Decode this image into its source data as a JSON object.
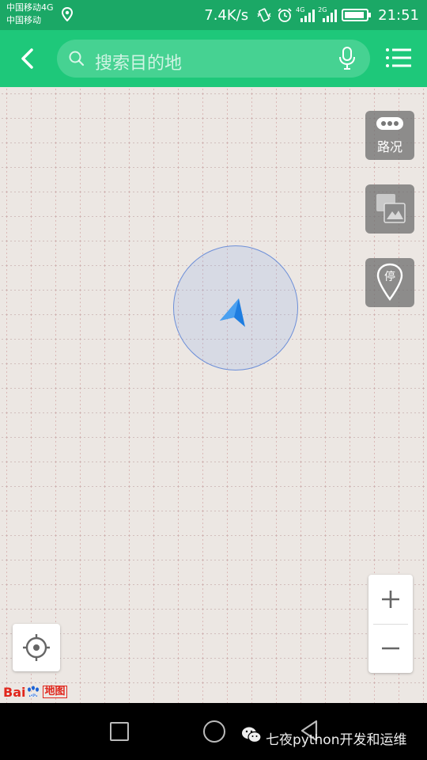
{
  "status_bar": {
    "carrier_1": "中国移动4G",
    "carrier_2": "中国移动",
    "net_speed": "7.4K/s",
    "sim1_tag": "4G",
    "sim2_tag": "2G",
    "time": "21:51"
  },
  "header": {
    "search_placeholder": "搜索目的地"
  },
  "map_controls": {
    "traffic_label": "路况",
    "parking_label": "停",
    "zoom_in": "+",
    "zoom_out": "−"
  },
  "logo": {
    "bai": "Bai",
    "du": "du",
    "map": "地图"
  },
  "watermark": "七夜python开发和运维",
  "colors": {
    "status_bar": "#1ba866",
    "app_bar": "#1ec87a",
    "map_bg": "#ece7e3",
    "nav_arrow": "#1e7de0",
    "logo_red": "#e1261c"
  },
  "icons": [
    "chevron-left-icon",
    "search-icon",
    "mic-icon",
    "menu-icon",
    "location-pin-icon",
    "alarm-icon",
    "layers-icon",
    "parking-icon",
    "crosshair-icon",
    "navigation-arrow-icon",
    "wechat-icon"
  ]
}
